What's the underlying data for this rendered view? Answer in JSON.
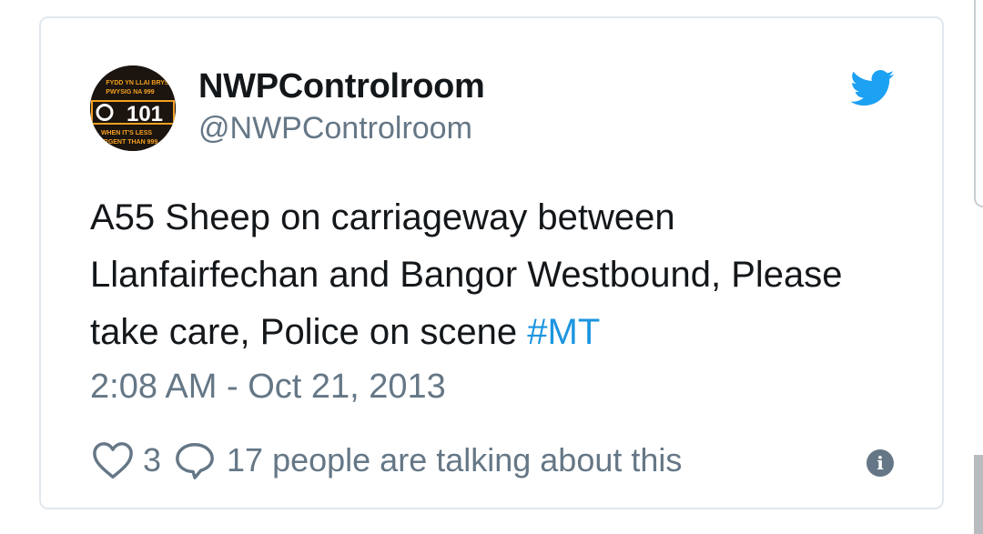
{
  "tweet": {
    "display_name": "NWPControlroom",
    "handle": "@NWPControlroom",
    "text": "A55 Sheep on carriageway between Llanfairfechan and Bangor Westbound, Please take care, Police on scene ",
    "hashtag": "#MT",
    "timestamp": "2:08 AM - Oct 21, 2013",
    "like_count": "3",
    "talking_text": "17 people are talking about this",
    "avatar": {
      "top_text": "FYDD YN LLAI BRYS",
      "line2": "PWYSIG NA 999",
      "number": "101",
      "line3": "WHEN IT'S LESS",
      "line4": "URGENT THAN 999"
    }
  },
  "icons": {
    "brand": "twitter-bird-icon",
    "like": "heart-icon",
    "reply": "speech-bubble-icon",
    "info": "info-icon"
  },
  "colors": {
    "twitter_blue": "#1da1f2",
    "hashtag": "#1b95e0",
    "secondary_text": "#657786",
    "primary_text": "#14171a",
    "avatar_orange": "#f4a020"
  },
  "info_glyph": "i"
}
